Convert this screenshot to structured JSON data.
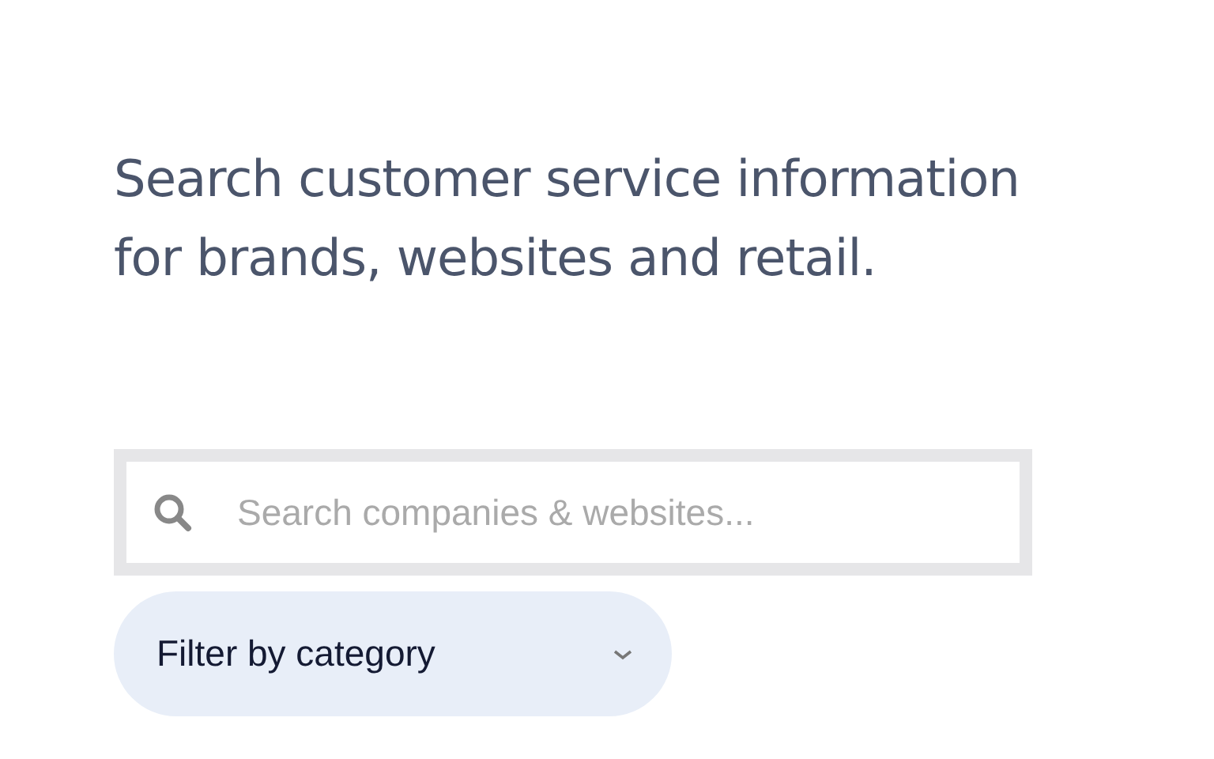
{
  "subtitle": "Search customer service information for brands, websites and retail.",
  "search": {
    "placeholder": "Search companies & websites..."
  },
  "filter": {
    "label": "Filter by category"
  }
}
